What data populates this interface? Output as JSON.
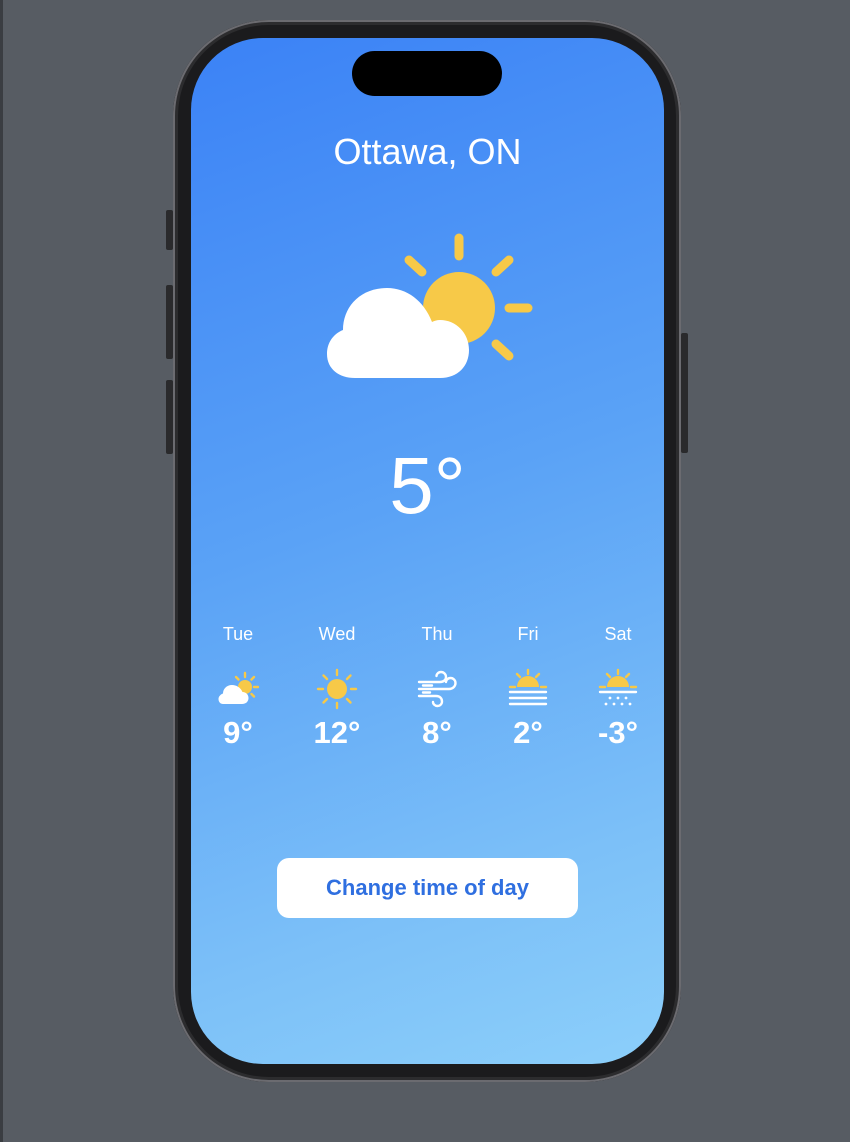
{
  "weather": {
    "city": "Ottawa, ON",
    "current_temp": "5°",
    "current_condition_icon": "cloud-sun-icon",
    "forecast": [
      {
        "day": "Tue",
        "temp": "9°",
        "icon": "cloud-sun-icon"
      },
      {
        "day": "Wed",
        "temp": "12°",
        "icon": "sun-icon"
      },
      {
        "day": "Thu",
        "temp": "8°",
        "icon": "wind-icon"
      },
      {
        "day": "Fri",
        "temp": "2°",
        "icon": "sunset-fog-icon"
      },
      {
        "day": "Sat",
        "temp": "-3°",
        "icon": "sun-snow-icon"
      }
    ]
  },
  "actions": {
    "change_time_label": "Change time of day"
  },
  "colors": {
    "background": "#575c63",
    "sky_top": "#3b82f6",
    "sky_bottom": "#8ccffa",
    "sun": "#f7c948",
    "button_text": "#2f6fe0"
  }
}
